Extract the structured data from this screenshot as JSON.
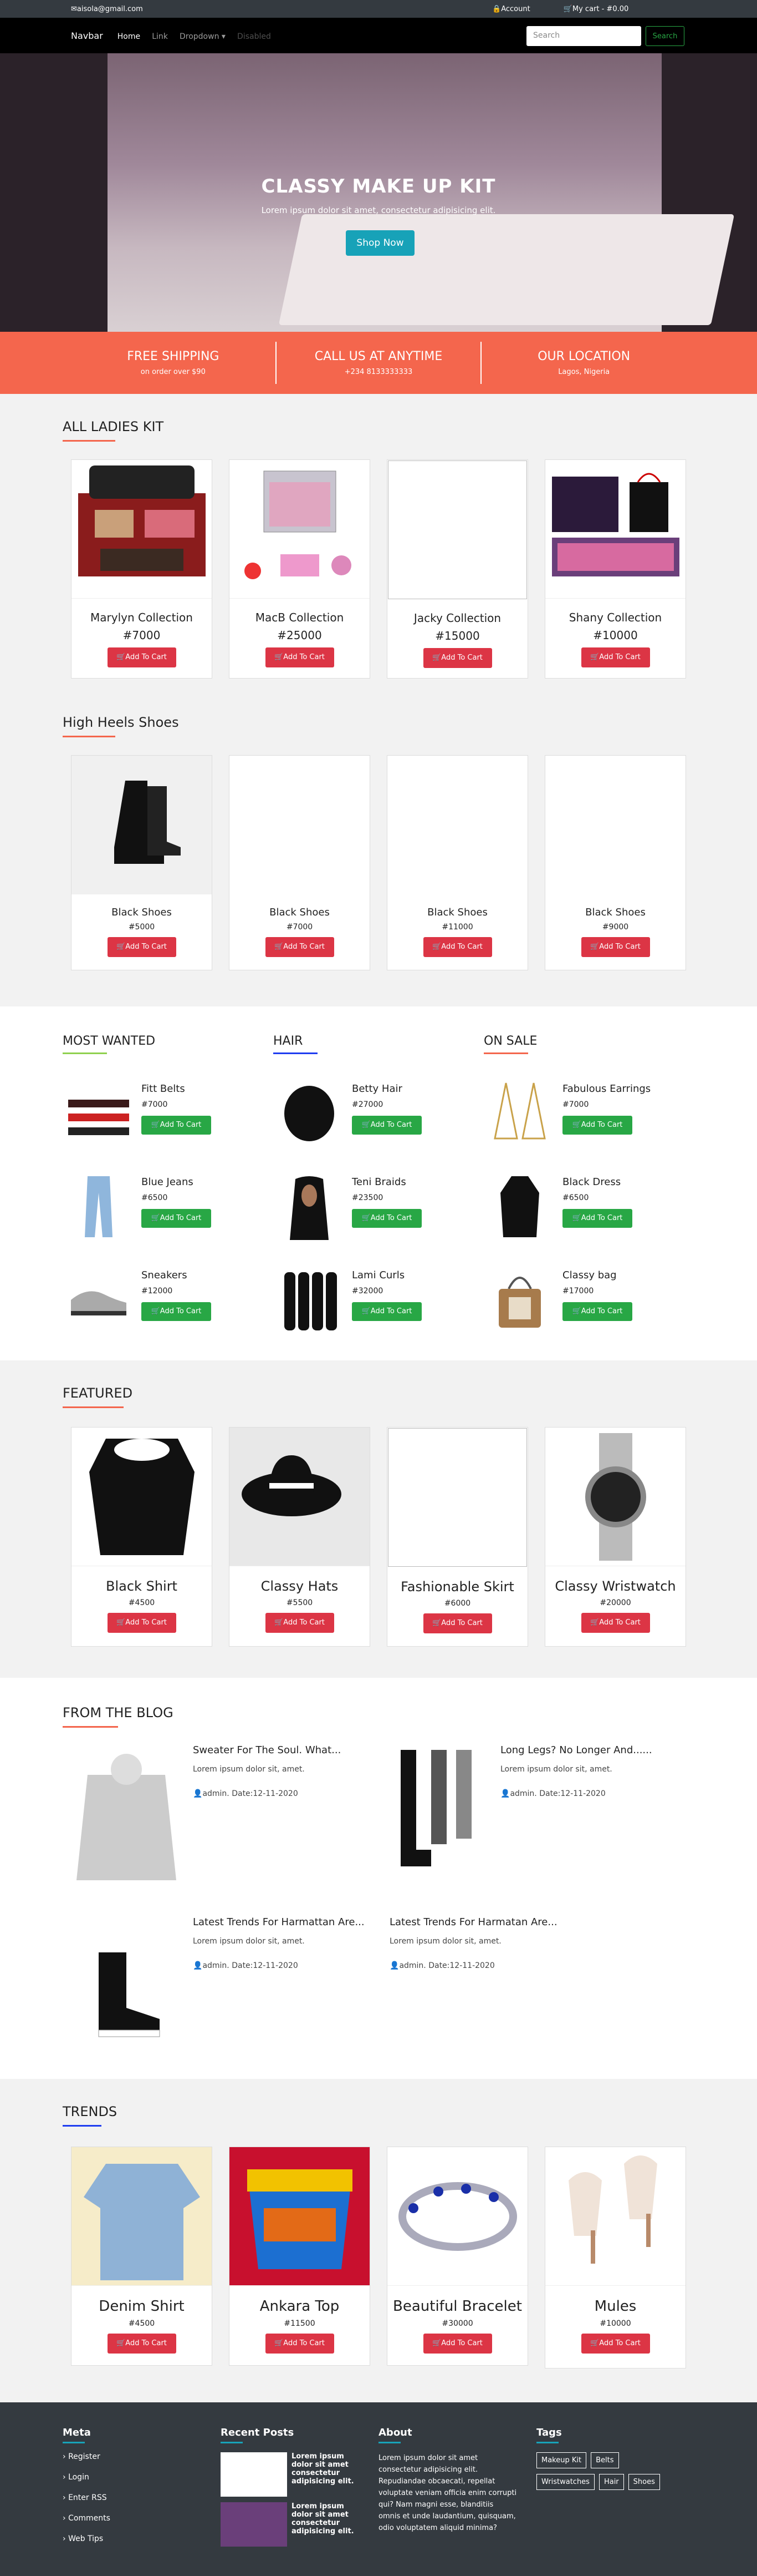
{
  "topbar": {
    "email": "aisola@gmail.com",
    "account": "Account",
    "cart": "My cart - #0.00"
  },
  "navbar": {
    "brand": "Navbar",
    "links": [
      "Home",
      "Link",
      "Dropdown",
      "Disabled"
    ],
    "search_placeholder": "Search",
    "search_btn": "Search"
  },
  "hero": {
    "title": "CLASSY MAKE UP KIT",
    "subtitle": "Lorem ipsum dolor sit amet, consectetur adipisicing elit.",
    "button": "Shop Now"
  },
  "info": [
    {
      "title": "FREE SHIPPING",
      "sub": "on order over $90"
    },
    {
      "title": "CALL US AT ANYTIME",
      "sub": "+234 8133333333"
    },
    {
      "title": "OUR LOCATION",
      "sub": "Lagos, Nigeria"
    }
  ],
  "ladies": {
    "title": "ALL LADIES KIT",
    "items": [
      {
        "name": "Marylyn Collection",
        "price": "#7000"
      },
      {
        "name": "MacB Collection",
        "price": "#25000"
      },
      {
        "name": "Jacky Collection",
        "price": "#15000"
      },
      {
        "name": "Shany Collection",
        "price": "#10000"
      }
    ]
  },
  "heels": {
    "title": "High Heels Shoes",
    "items": [
      {
        "name": "Black Shoes",
        "price": "#5000"
      },
      {
        "name": "Black Shoes",
        "price": "#7000"
      },
      {
        "name": "Black Shoes",
        "price": "#11000"
      },
      {
        "name": "Black Shoes",
        "price": "#9000"
      }
    ]
  },
  "add_to_cart": "Add To Cart",
  "lists": [
    {
      "title": "MOST WANTED",
      "color": "#8fd14f",
      "items": [
        {
          "name": "Fitt Belts",
          "price": "#7000"
        },
        {
          "name": "Blue Jeans",
          "price": "#6500"
        },
        {
          "name": "Sneakers",
          "price": "#12000"
        }
      ]
    },
    {
      "title": "HAIR",
      "color": "#1f3df0",
      "items": [
        {
          "name": "Betty Hair",
          "price": "#27000"
        },
        {
          "name": "Teni Braids",
          "price": "#23500"
        },
        {
          "name": "Lami Curls",
          "price": "#32000"
        }
      ]
    },
    {
      "title": "ON SALE",
      "color": "#f4664d",
      "items": [
        {
          "name": "Fabulous Earrings",
          "price": "#7000"
        },
        {
          "name": "Black Dress",
          "price": "#6500"
        },
        {
          "name": "Classy bag",
          "price": "#17000"
        }
      ]
    }
  ],
  "featured": {
    "title": "FEATURED",
    "items": [
      {
        "name": "Black Shirt",
        "price": "#4500"
      },
      {
        "name": "Classy Hats",
        "price": "#5500"
      },
      {
        "name": "Fashionable Skirt",
        "price": "#6000"
      },
      {
        "name": "Classy Wristwatch",
        "price": "#20000"
      }
    ]
  },
  "blog": {
    "title": "FROM THE BLOG",
    "posts": [
      {
        "title": "Sweater For The Soul. What...",
        "desc": "Lorem ipsum dolor sit, amet.",
        "meta": "admin. Date:12-11-2020"
      },
      {
        "title": "Long Legs? No Longer And......",
        "desc": "Lorem ipsum dolor sit, amet.",
        "meta": "admin. Date:12-11-2020"
      },
      {
        "title": "Latest Trends For Harmattan Are...",
        "desc": "Lorem ipsum dolor sit, amet.",
        "meta": "admin. Date:12-11-2020"
      },
      {
        "title": "Latest Trends For Harmatan Are...",
        "desc": "Lorem ipsum dolor sit, amet.",
        "meta": "admin. Date:12-11-2020"
      }
    ]
  },
  "trends": {
    "title": "TRENDS",
    "items": [
      {
        "name": "Denim Shirt",
        "price": "#4500"
      },
      {
        "name": "Ankara Top",
        "price": "#11500"
      },
      {
        "name": "Beautiful Bracelet",
        "price": "#30000"
      },
      {
        "name": "Mules",
        "price": "#10000"
      }
    ]
  },
  "footer": {
    "meta_title": "Meta",
    "meta_links": [
      "Register",
      "Login",
      "Enter RSS",
      "Comments",
      "Web Tips"
    ],
    "recent_title": "Recent Posts",
    "recent": [
      "Lorem ipsum dolor sit amet consectetur adipisicing elit.",
      "Lorem ipsum dolor sit amet consectetur adipisicing elit."
    ],
    "about_title": "About",
    "about_text": "Lorem ipsum dolor sit amet consectetur adipisicing elit. Repudiandae obcaecati, repellat voluptate veniam officia enim corrupti qui? Nam magni esse, blanditiis omnis et unde laudantium, quisquam, odio voluptatem aliquid minima?",
    "tags_title": "Tags",
    "tags": [
      "Makeup Kit",
      "Belts",
      "Wristwatches",
      "Hair",
      "Shoes"
    ]
  }
}
